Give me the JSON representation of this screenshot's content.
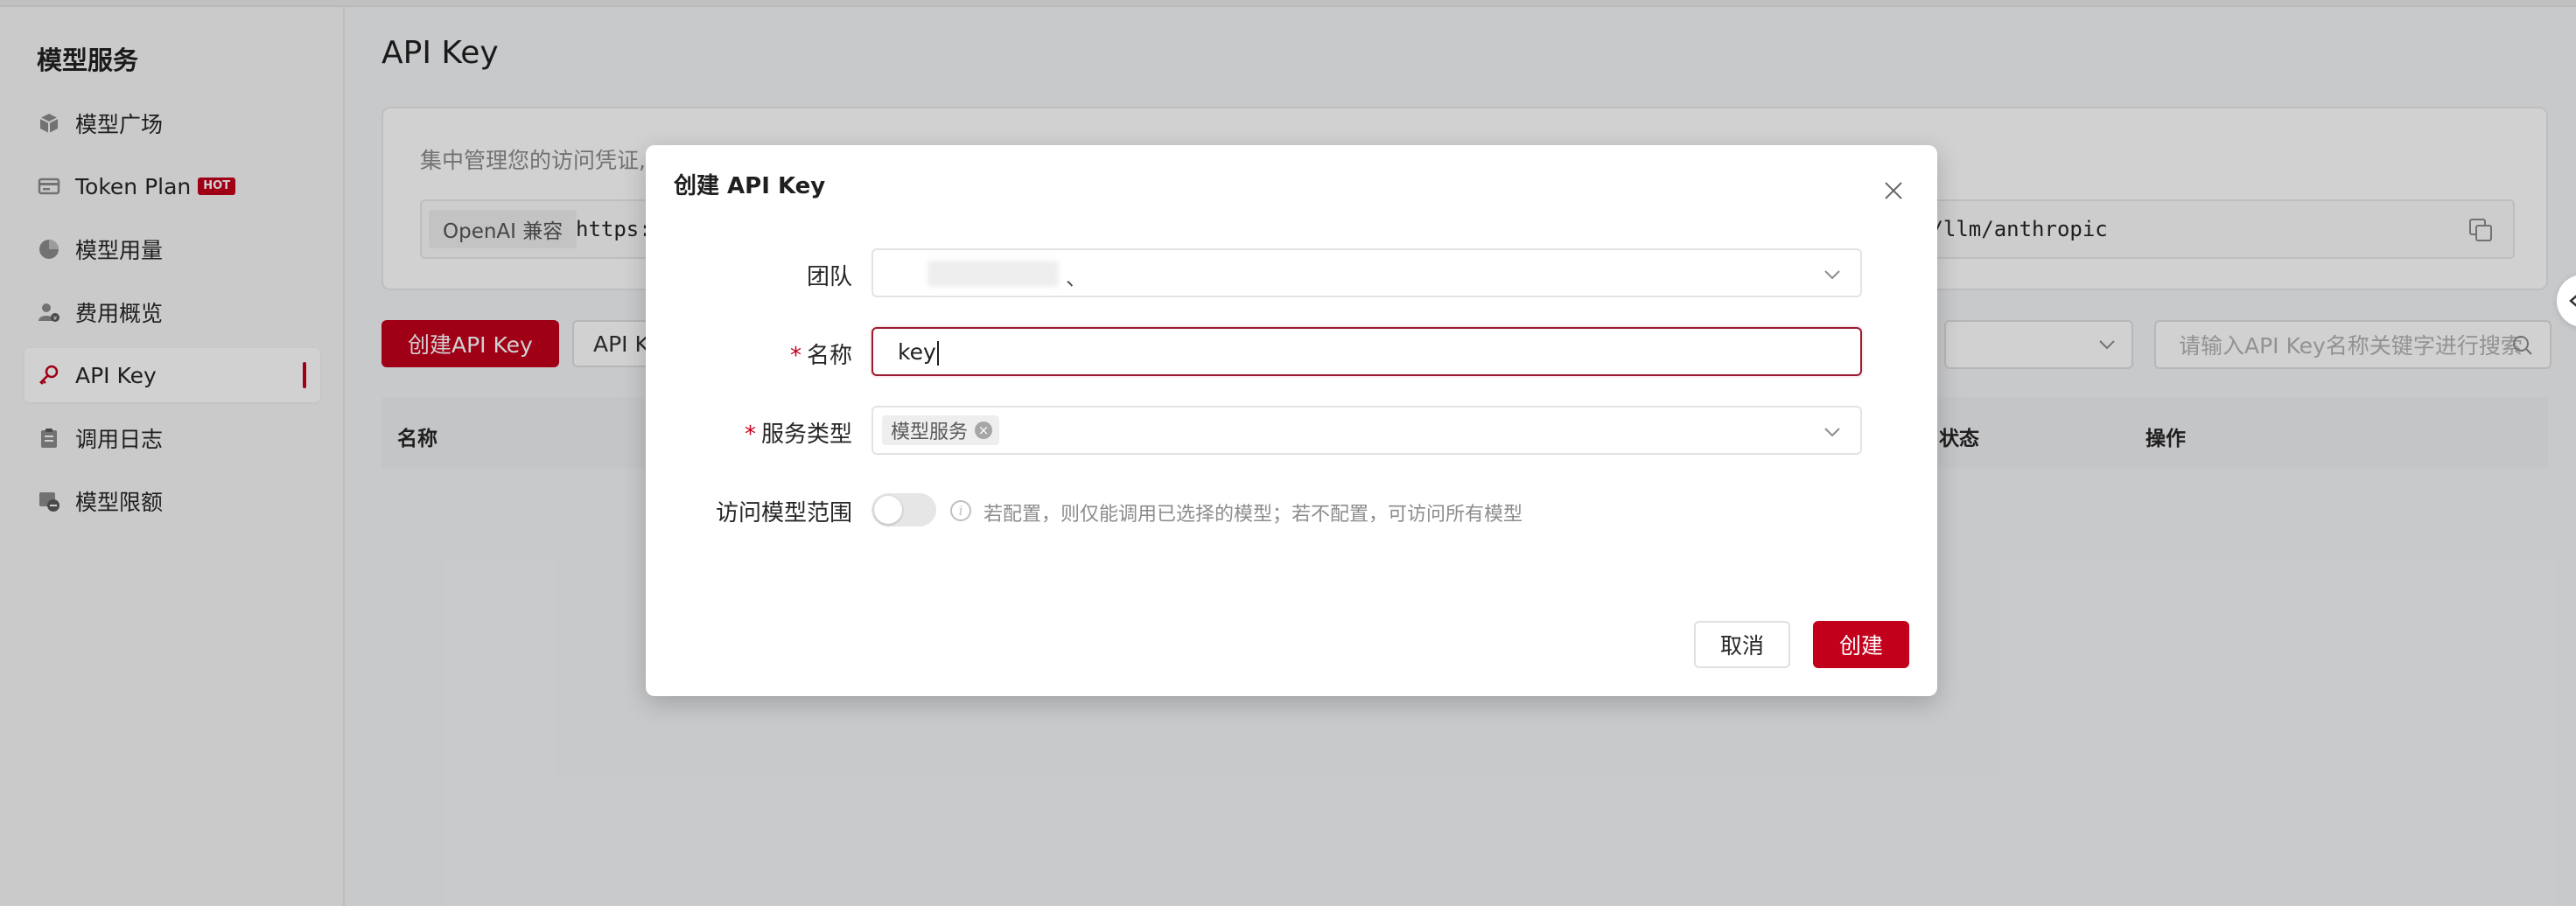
{
  "sidebar": {
    "title": "模型服务",
    "items": [
      {
        "label": "模型广场",
        "icon": "cube-icon"
      },
      {
        "label": "Token Plan",
        "icon": "card-icon",
        "badge": "HOT"
      },
      {
        "label": "模型用量",
        "icon": "pie-chart-icon"
      },
      {
        "label": "费用概览",
        "icon": "user-coin-icon"
      },
      {
        "label": "API Key",
        "icon": "key-icon",
        "active": true
      },
      {
        "label": "调用日志",
        "icon": "clipboard-icon"
      },
      {
        "label": "模型限额",
        "icon": "limit-icon"
      }
    ]
  },
  "main": {
    "page_title": "API Key",
    "info": {
      "description": "集中管理您的访问凭证,",
      "tag": "OpenAI 兼容",
      "url_left": "https:",
      "url_right": "i/llm/anthropic"
    },
    "create_button": "创建API Key",
    "filter_tab": "API K",
    "search_placeholder": "请输入API Key名称关键字进行搜索",
    "table_headers": {
      "name": "名称",
      "status": "状态",
      "actions": "操作"
    }
  },
  "modal": {
    "title": "创建 API Key",
    "team": {
      "label": "团队",
      "value_suffix": "、"
    },
    "name": {
      "label": "名称",
      "value": "key"
    },
    "service_type": {
      "label": "服务类型",
      "tag": "模型服务"
    },
    "model_scope": {
      "label": "访问模型范围",
      "hint": "若配置，则仅能调用已选择的模型；若不配置，可访问所有模型",
      "enabled": false
    },
    "cancel": "取消",
    "confirm": "创建"
  },
  "colors": {
    "brand": "#c3001c"
  }
}
